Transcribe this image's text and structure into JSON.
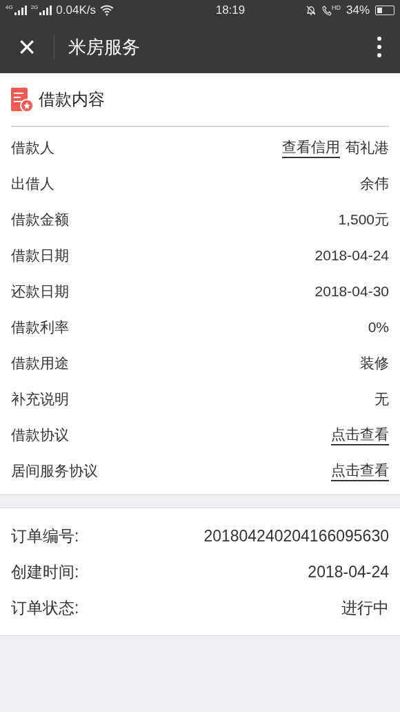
{
  "status_bar": {
    "net1": "4G",
    "net2": "2G",
    "speed": "0.04K/s",
    "time": "18:19",
    "hd": "HD",
    "battery": "34%"
  },
  "app_bar": {
    "close": "×",
    "title": "米房服务"
  },
  "loan": {
    "title": "借款内容",
    "rows": [
      {
        "label": "借款人",
        "kind": "text",
        "value": "荀礼港",
        "action": "查看信用"
      },
      {
        "label": "出借人",
        "kind": "text",
        "value": "余伟"
      },
      {
        "label": "借款金额",
        "kind": "text",
        "value": "1,500元"
      },
      {
        "label": "借款日期",
        "kind": "text",
        "value": "2018-04-24"
      },
      {
        "label": "还款日期",
        "kind": "text",
        "value": "2018-04-30"
      },
      {
        "label": "借款利率",
        "kind": "text",
        "value": "0%"
      },
      {
        "label": "借款用途",
        "kind": "text",
        "value": "装修"
      },
      {
        "label": "补充说明",
        "kind": "text",
        "value": "无"
      },
      {
        "label": "借款协议",
        "kind": "link",
        "value": "点击查看"
      },
      {
        "label": "居间服务协议",
        "kind": "link",
        "value": "点击查看"
      }
    ]
  },
  "order": {
    "rows": [
      {
        "label": "订单编号:",
        "value": "201804240204166095630"
      },
      {
        "label": "创建时间:",
        "value": "2018-04-24"
      },
      {
        "label": "订单状态:",
        "value": "进行中"
      }
    ]
  }
}
